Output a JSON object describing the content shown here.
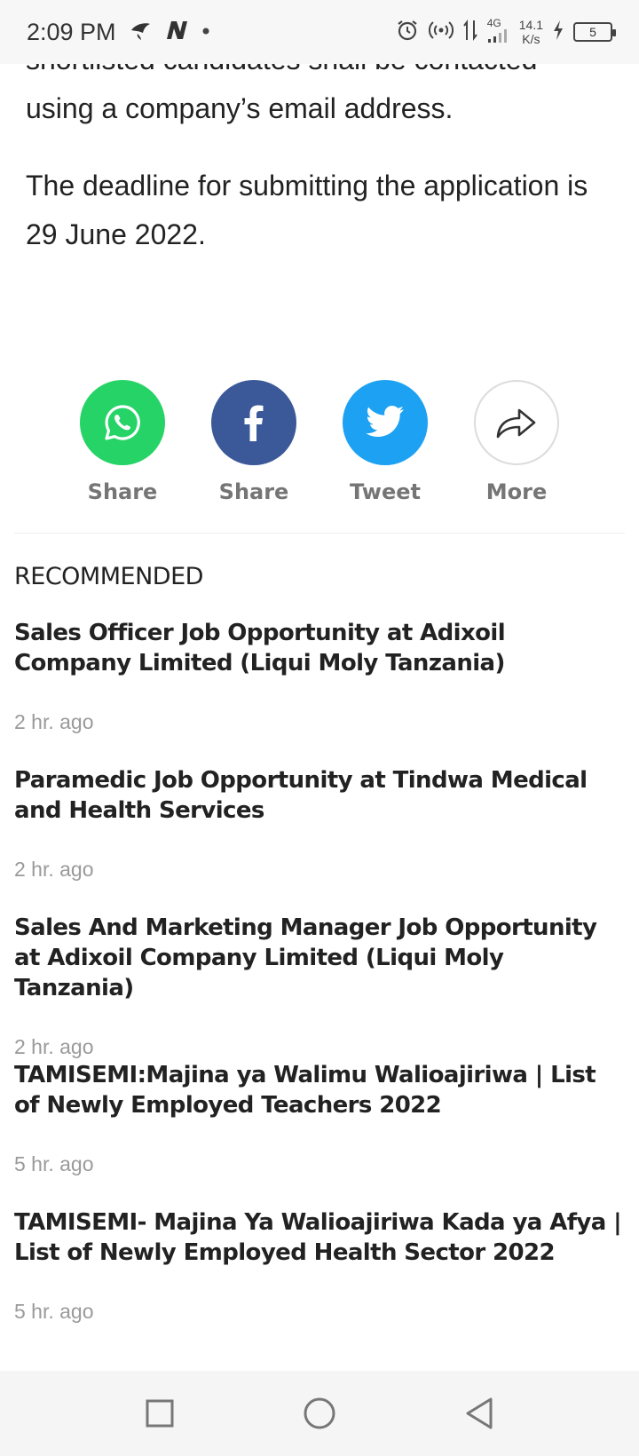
{
  "status": {
    "time": "2:09 PM",
    "network_gen": "4G",
    "net_speed_value": "14.1",
    "net_speed_unit": "K/s",
    "battery": "5"
  },
  "article": {
    "paragraph1_line1": "shortlisted candidates shall be contacted",
    "paragraph1_line2": "using a company’s email address.",
    "paragraph2": "The deadline for submitting the application is 29 June 2022."
  },
  "share": {
    "whatsapp_label": "Share",
    "facebook_label": "Share",
    "twitter_label": "Tweet",
    "more_label": "More",
    "colors": {
      "whatsapp": "#25d366",
      "facebook": "#3b5998",
      "twitter": "#1da1f2"
    }
  },
  "recommended": {
    "header": "RECOMMENDED",
    "items": [
      {
        "title": "Sales Officer Job Opportunity at Adixoil Company Limited (Liqui Moly Tanzania)",
        "time": "2 hr. ago"
      },
      {
        "title": "Paramedic Job Opportunity at Tindwa Medical and Health Services",
        "time": "2 hr. ago"
      },
      {
        "title": "Sales And Marketing Manager Job Opportunity at Adixoil Company Limited (Liqui Moly Tanzania)",
        "time": "2 hr. ago"
      },
      {
        "title": "TAMISEMI:Majina ya Walimu Walioajiriwa | List of Newly Employed Teachers 2022",
        "time": "5 hr. ago"
      },
      {
        "title": "TAMISEMI- Majina Ya Walioajiriwa Kada ya Afya | List of Newly Employed Health Sector 2022",
        "time": "5 hr. ago"
      }
    ]
  },
  "nav": {
    "icons": [
      "recents-square-icon",
      "home-circle-icon",
      "back-triangle-icon"
    ]
  }
}
